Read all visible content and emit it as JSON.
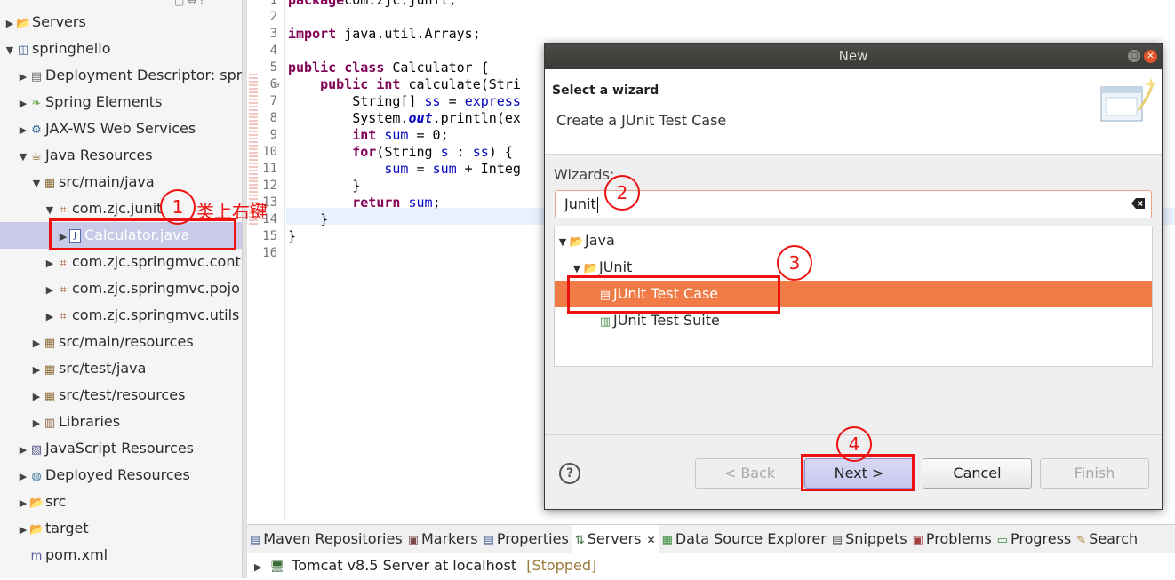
{
  "explorer": {
    "items": [
      {
        "label": "Servers",
        "icon": "folder-icon",
        "indent": 0,
        "expander": "collapsed"
      },
      {
        "label": "springhello",
        "icon": "web-project-icon",
        "indent": 0,
        "expander": "expanded"
      },
      {
        "label": "Deployment Descriptor: sprin",
        "icon": "deployment-descriptor-icon",
        "indent": 1,
        "expander": "collapsed"
      },
      {
        "label": "Spring Elements",
        "icon": "spring-leaf-icon",
        "indent": 1,
        "expander": "collapsed"
      },
      {
        "label": "JAX-WS Web Services",
        "icon": "web-services-icon",
        "indent": 1,
        "expander": "collapsed"
      },
      {
        "label": "Java Resources",
        "icon": "java-resources-icon",
        "indent": 1,
        "expander": "expanded"
      },
      {
        "label": "src/main/java",
        "icon": "source-folder-icon",
        "indent": 2,
        "expander": "expanded"
      },
      {
        "label": "com.zjc.junit",
        "icon": "package-icon",
        "indent": 3,
        "expander": "expanded"
      },
      {
        "label": "Calculator.java",
        "icon": "java-file-icon",
        "indent": 4,
        "expander": "collapsed",
        "selected": true
      },
      {
        "label": "com.zjc.springmvc.contro",
        "icon": "package-icon",
        "indent": 3,
        "expander": "collapsed"
      },
      {
        "label": "com.zjc.springmvc.pojo",
        "icon": "package-icon",
        "indent": 3,
        "expander": "collapsed"
      },
      {
        "label": "com.zjc.springmvc.utils",
        "icon": "package-icon",
        "indent": 3,
        "expander": "collapsed"
      },
      {
        "label": "src/main/resources",
        "icon": "source-folder-icon",
        "indent": 2,
        "expander": "collapsed"
      },
      {
        "label": "src/test/java",
        "icon": "source-folder-icon",
        "indent": 2,
        "expander": "collapsed"
      },
      {
        "label": "src/test/resources",
        "icon": "source-folder-icon",
        "indent": 2,
        "expander": "collapsed"
      },
      {
        "label": "Libraries",
        "icon": "libraries-icon",
        "indent": 2,
        "expander": "collapsed"
      },
      {
        "label": "JavaScript Resources",
        "icon": "javascript-resources-icon",
        "indent": 1,
        "expander": "collapsed"
      },
      {
        "label": "Deployed Resources",
        "icon": "deployed-resources-icon",
        "indent": 1,
        "expander": "collapsed"
      },
      {
        "label": "src",
        "icon": "folder-icon",
        "indent": 1,
        "expander": "collapsed"
      },
      {
        "label": "target",
        "icon": "folder-icon",
        "indent": 1,
        "expander": "collapsed"
      },
      {
        "label": "pom.xml",
        "icon": "xml-file-icon",
        "indent": 1,
        "expander": "none"
      }
    ]
  },
  "editor": {
    "lines": [
      {
        "n": "1",
        "tokens": [
          [
            "kw",
            "package"
          ],
          [
            "",
            "com.zjc.junit;"
          ]
        ]
      },
      {
        "n": "2",
        "tokens": []
      },
      {
        "n": "3",
        "tokens": [
          [
            "kw",
            "import"
          ],
          [
            "",
            " java.util.Arrays;"
          ]
        ]
      },
      {
        "n": "4",
        "tokens": []
      },
      {
        "n": "5",
        "tokens": [
          [
            "kw",
            "public"
          ],
          [
            "",
            " "
          ],
          [
            "kw",
            "class"
          ],
          [
            "",
            " Calculator {"
          ]
        ]
      },
      {
        "n": "6",
        "tokens": [
          [
            "",
            "    "
          ],
          [
            "kw",
            "public"
          ],
          [
            "",
            " "
          ],
          [
            "kw",
            "int"
          ],
          [
            "",
            " calculate(Stri"
          ]
        ]
      },
      {
        "n": "7",
        "tokens": [
          [
            "",
            "        String[] "
          ],
          [
            "var",
            "ss"
          ],
          [
            "",
            " = "
          ],
          [
            "var",
            "express"
          ]
        ]
      },
      {
        "n": "8",
        "tokens": [
          [
            "",
            "        System."
          ],
          [
            "fld",
            "out"
          ],
          [
            "",
            ".println(ex"
          ]
        ]
      },
      {
        "n": "9",
        "tokens": [
          [
            "",
            "        "
          ],
          [
            "kw",
            "int"
          ],
          [
            "",
            " "
          ],
          [
            "var",
            "sum"
          ],
          [
            "",
            " = 0;"
          ]
        ]
      },
      {
        "n": "10",
        "tokens": [
          [
            "",
            "        "
          ],
          [
            "kw",
            "for"
          ],
          [
            "",
            "(String "
          ],
          [
            "var",
            "s"
          ],
          [
            "",
            " : "
          ],
          [
            "var",
            "ss"
          ],
          [
            "",
            ") {"
          ]
        ]
      },
      {
        "n": "11",
        "tokens": [
          [
            "",
            "            "
          ],
          [
            "var",
            "sum"
          ],
          [
            "",
            " = "
          ],
          [
            "var",
            "sum"
          ],
          [
            "",
            " + Integ"
          ]
        ]
      },
      {
        "n": "12",
        "tokens": [
          [
            "",
            "        }"
          ]
        ]
      },
      {
        "n": "13",
        "tokens": [
          [
            "",
            "        "
          ],
          [
            "kw",
            "return"
          ],
          [
            "",
            " "
          ],
          [
            "var",
            "sum"
          ],
          [
            "",
            ";"
          ]
        ]
      },
      {
        "n": "14",
        "tokens": [
          [
            "",
            "    }"
          ]
        ]
      },
      {
        "n": "15",
        "tokens": [
          [
            "",
            "}"
          ]
        ]
      },
      {
        "n": "16",
        "tokens": []
      }
    ],
    "fold_marker": "⊖"
  },
  "bottom": {
    "tabs": [
      {
        "label": "Maven Repositories",
        "icon": "maven-repositories-icon"
      },
      {
        "label": "Markers",
        "icon": "markers-icon"
      },
      {
        "label": "Properties",
        "icon": "properties-icon"
      },
      {
        "label": "Servers",
        "icon": "servers-icon",
        "active": true
      },
      {
        "label": "Data Source Explorer",
        "icon": "data-source-explorer-icon"
      },
      {
        "label": "Snippets",
        "icon": "snippets-icon"
      },
      {
        "label": "Problems",
        "icon": "problems-icon"
      },
      {
        "label": "Progress",
        "icon": "progress-icon"
      },
      {
        "label": "Search",
        "icon": "search-icon"
      }
    ],
    "server_name": "Tomcat v8.5 Server at localhost",
    "server_state": "[Stopped]"
  },
  "dialog": {
    "title": "New",
    "header_title": "Select a wizard",
    "header_desc": "Create a JUnit Test Case",
    "wizards_label": "Wizards:",
    "filter_value": "Junit",
    "tree": [
      {
        "label": "Java",
        "indent": 0,
        "expander": "expanded",
        "icon": "folder-open-icon"
      },
      {
        "label": "JUnit",
        "indent": 1,
        "expander": "expanded",
        "icon": "folder-open-icon"
      },
      {
        "label": "JUnit Test Case",
        "indent": 2,
        "expander": "none",
        "icon": "junit-test-case-icon",
        "selected": true
      },
      {
        "label": "JUnit Test Suite",
        "indent": 2,
        "expander": "none",
        "icon": "junit-test-suite-icon"
      }
    ],
    "buttons": {
      "back": "< Back",
      "next": "Next >",
      "cancel": "Cancel",
      "finish": "Finish"
    },
    "help_symbol": "?"
  },
  "annotations": {
    "step1": "1",
    "step1_note": "类上右键",
    "step2": "2",
    "step3": "3",
    "step4": "4",
    "color": "#ee1111"
  },
  "colors": {
    "selection": "#f07b46",
    "keyword": "#7f0055",
    "variable": "#0000c0",
    "accent": "#e11"
  }
}
